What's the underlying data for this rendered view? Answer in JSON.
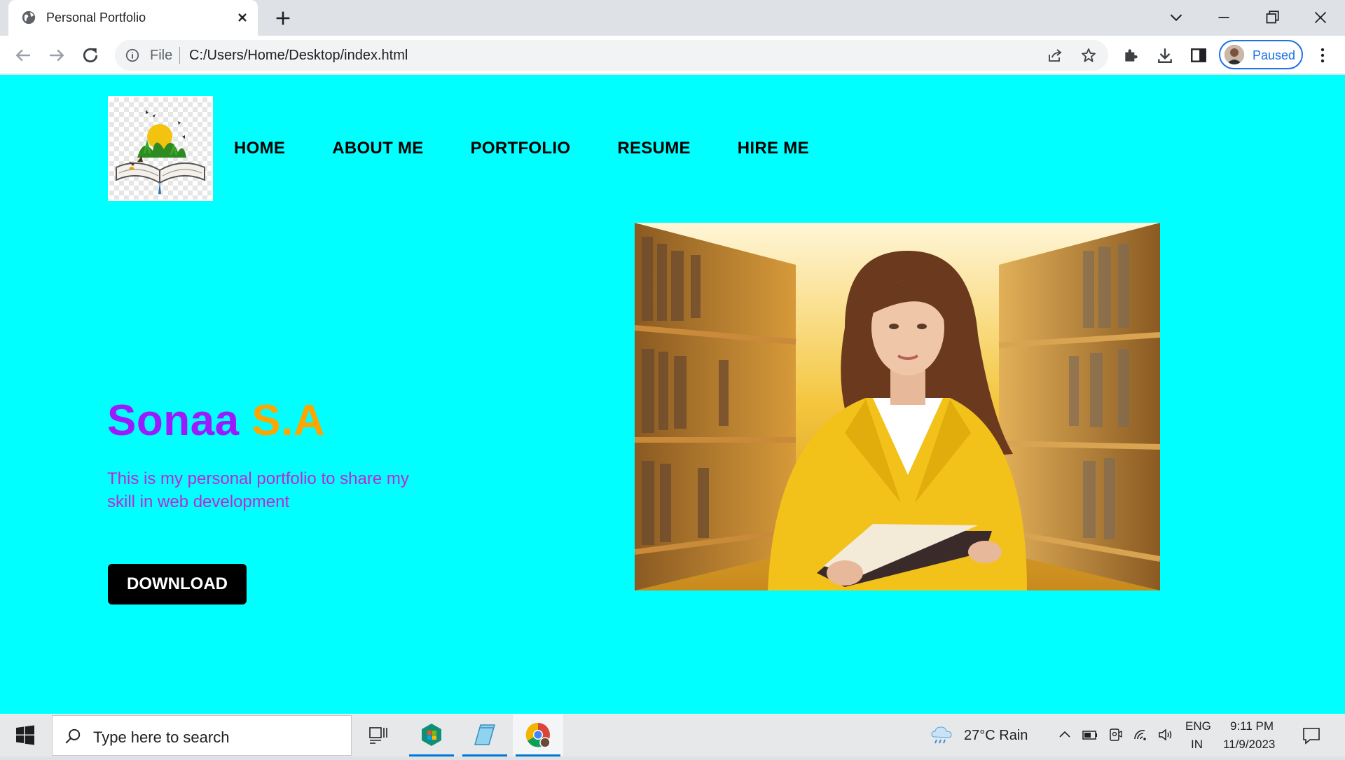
{
  "browser": {
    "tab_title": "Personal Portfolio",
    "scheme_label": "File",
    "url": "C:/Users/Home/Desktop/index.html",
    "profile_label": "Paused"
  },
  "nav": {
    "items": [
      "HOME",
      "ABOUT ME",
      "PORTFOLIO",
      "RESUME",
      "HIRE ME"
    ]
  },
  "hero": {
    "first_name": "Sonaa",
    "last_name": "S.A",
    "description": "This is my personal portfolio to share my skill in web development",
    "button_label": "DOWNLOAD"
  },
  "colors": {
    "page_background": "#00ffff",
    "first_name": "#9d1aff",
    "last_name": "#ffa500",
    "description": "#c026d3",
    "button": "#000000"
  },
  "taskbar": {
    "search_placeholder": "Type here to search",
    "weather": "27°C  Rain",
    "language": "ENG",
    "region": "IN",
    "time": "9:11 PM",
    "date": "11/9/2023"
  }
}
